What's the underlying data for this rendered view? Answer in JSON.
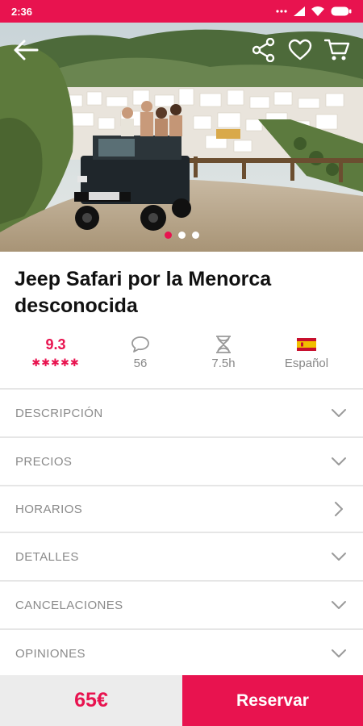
{
  "status_bar": {
    "time": "2:36",
    "icons": [
      "more-dots-icon",
      "signal-icon",
      "wifi-icon",
      "battery-icon"
    ]
  },
  "hero": {
    "image": "jeep-safari-photo",
    "slides_total": 3,
    "active_slide": 1
  },
  "title": "Jeep Safari por la Menorca desconocida",
  "info": {
    "rating": "9.3",
    "stars": "✱✱✱✱✱",
    "stars_count": 5,
    "comments": "56",
    "duration": "7.5h",
    "language": "Español"
  },
  "sections": [
    {
      "label": "DESCRIPCIÓN",
      "icon": "chevron-down-icon"
    },
    {
      "label": "PRECIOS",
      "icon": "chevron-down-icon"
    },
    {
      "label": "HORARIOS",
      "icon": "chevron-right-icon"
    },
    {
      "label": "DETALLES",
      "icon": "chevron-down-icon"
    },
    {
      "label": "CANCELACIONES",
      "icon": "chevron-down-icon"
    },
    {
      "label": "OPINIONES",
      "icon": "chevron-down-icon"
    }
  ],
  "footer": {
    "price": "65€",
    "reserve_label": "Reservar"
  },
  "colors": {
    "accent": "#e8134f",
    "muted_text": "#8a8a8a",
    "divider": "#e6e6e6",
    "footer_bg": "#ececec"
  }
}
